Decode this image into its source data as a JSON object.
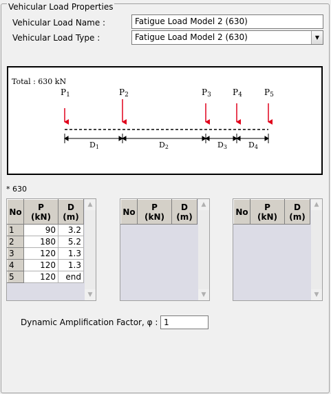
{
  "group_title": "Vehicular Load Properties",
  "form": {
    "name_label": "Vehicular Load Name :",
    "name_value": "Fatigue Load Model 2 (630)",
    "type_label": "Vehicular Load Type :",
    "type_value": "Fatigue Load Model 2 (630)"
  },
  "diagram": {
    "total_label": "Total : 630 kN",
    "loads": [
      {
        "label": "P",
        "sub": "1"
      },
      {
        "label": "P",
        "sub": "2"
      },
      {
        "label": "P",
        "sub": "3"
      },
      {
        "label": "P",
        "sub": "4"
      },
      {
        "label": "P",
        "sub": "5"
      }
    ],
    "dims": [
      {
        "label": "D",
        "sub": "1"
      },
      {
        "label": "D",
        "sub": "2"
      },
      {
        "label": "D",
        "sub": "3"
      },
      {
        "label": "D",
        "sub": "4"
      }
    ],
    "arrow_color": "#e0001a"
  },
  "note": "* 630",
  "tables": {
    "headers": {
      "no": "No",
      "p_line1": "P",
      "p_line2": "(kN)",
      "d_line1": "D",
      "d_line2": "(m)"
    },
    "table1_rows": [
      {
        "no": "1",
        "p": "90",
        "d": "3.2"
      },
      {
        "no": "2",
        "p": "180",
        "d": "5.2"
      },
      {
        "no": "3",
        "p": "120",
        "d": "1.3"
      },
      {
        "no": "4",
        "p": "120",
        "d": "1.3"
      },
      {
        "no": "5",
        "p": "120",
        "d": "end"
      }
    ]
  },
  "daf": {
    "label": "Dynamic Amplification Factor, φ :",
    "value": "1"
  }
}
